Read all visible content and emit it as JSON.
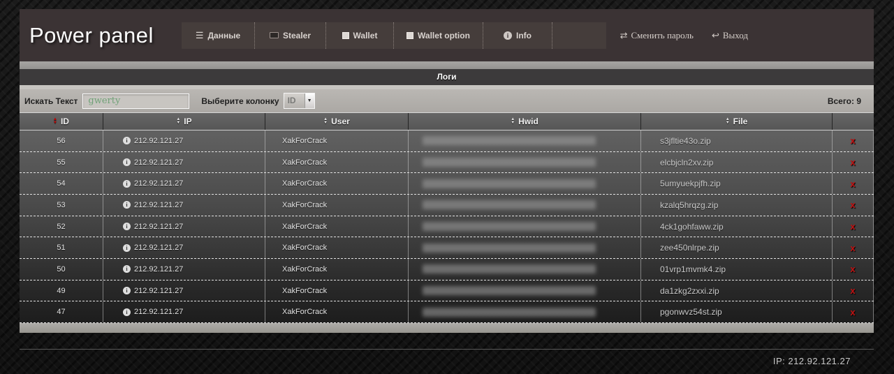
{
  "header": {
    "title": "Power panel",
    "nav": [
      {
        "label": "Данные",
        "icon": "menu-icon"
      },
      {
        "label": "Stealer",
        "icon": "stealer-icon"
      },
      {
        "label": "Wallet",
        "icon": "wallet-icon"
      },
      {
        "label": "Wallet option",
        "icon": "wallet-option-icon"
      },
      {
        "label": "Info",
        "icon": "info-icon"
      }
    ],
    "actions": [
      {
        "label": "Сменить пароль",
        "icon": "swap-arrows-icon"
      },
      {
        "label": "Выход",
        "icon": "logout-icon"
      }
    ]
  },
  "section": {
    "title": "Логи"
  },
  "search": {
    "label": "Искать Текст",
    "query": "gwerty",
    "column_label": "Выберите колонку",
    "column_selected": "ID",
    "total": "Всего: 9"
  },
  "table": {
    "columns": [
      "ID",
      "IP",
      "User",
      "Hwid",
      "File"
    ],
    "delete_label": "x",
    "rows": [
      {
        "id": "56",
        "ip": "212.92.121.27",
        "user": "XakForCrack",
        "file": "s3jfltie43o.zip"
      },
      {
        "id": "55",
        "ip": "212.92.121.27",
        "user": "XakForCrack",
        "file": "elcbjcln2xv.zip"
      },
      {
        "id": "54",
        "ip": "212.92.121.27",
        "user": "XakForCrack",
        "file": "5umyuekpjfh.zip"
      },
      {
        "id": "53",
        "ip": "212.92.121.27",
        "user": "XakForCrack",
        "file": "kzalq5hrqzg.zip"
      },
      {
        "id": "52",
        "ip": "212.92.121.27",
        "user": "XakForCrack",
        "file": "4ck1gohfaww.zip"
      },
      {
        "id": "51",
        "ip": "212.92.121.27",
        "user": "XakForCrack",
        "file": "zee450nlrpe.zip"
      },
      {
        "id": "50",
        "ip": "212.92.121.27",
        "user": "XakForCrack",
        "file": "01vrp1mvmk4.zip"
      },
      {
        "id": "49",
        "ip": "212.92.121.27",
        "user": "XakForCrack",
        "file": "da1zkg2zxxi.zip"
      },
      {
        "id": "47",
        "ip": "212.92.121.27",
        "user": "XakForCrack",
        "file": "pgonwvz54st.zip"
      }
    ]
  },
  "footer": {
    "ip": "IP: 212.92.121.27"
  },
  "colors": {
    "header_bg": "#3b3334",
    "accent_red": "#c11212",
    "input_text_green": "#6fa177",
    "table_header_bg": "#5c5c5c"
  }
}
